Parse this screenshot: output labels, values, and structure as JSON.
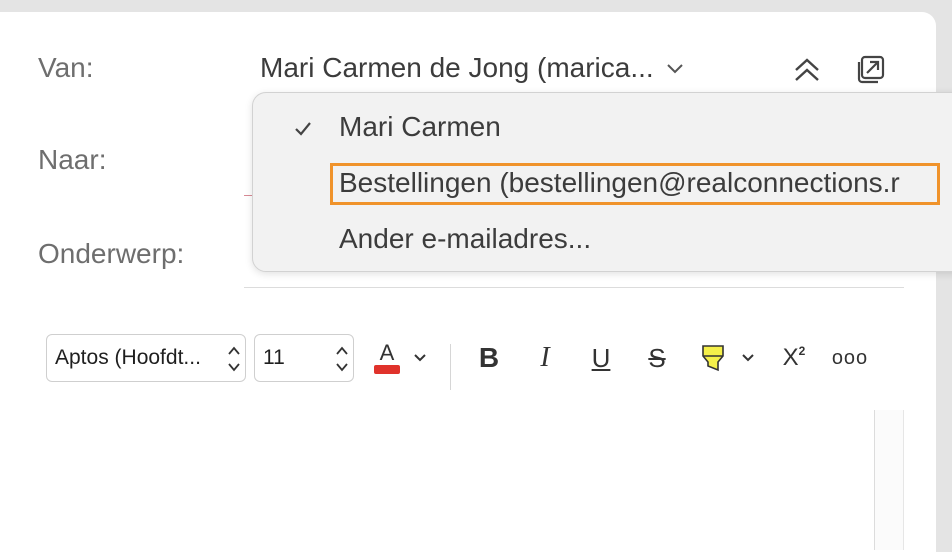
{
  "header": {
    "from_label": "Van:",
    "to_label": "Naar:",
    "subject_label": "Onderwerp:",
    "from_value": "Mari Carmen de Jong (marica..."
  },
  "dropdown": {
    "items": [
      {
        "label": "Mari Carmen",
        "checked": true
      },
      {
        "label": "Bestellingen (bestellingen@realconnections.r",
        "checked": false,
        "highlighted": true
      },
      {
        "label": "Ander e-mailadres...",
        "checked": false
      }
    ]
  },
  "toolbar": {
    "font_name": "Aptos (Hoofdt...",
    "font_size": "11",
    "font_color": "#e0322b",
    "highlight_color": "#f5f04a",
    "font_color_glyph": "A",
    "bold": "B",
    "italic": "I",
    "underline": "U",
    "strike": "S",
    "superscript_base": "X",
    "superscript_exp": "2",
    "more": "ooo"
  },
  "colors": {
    "highlight_outline": "#f0932b"
  }
}
